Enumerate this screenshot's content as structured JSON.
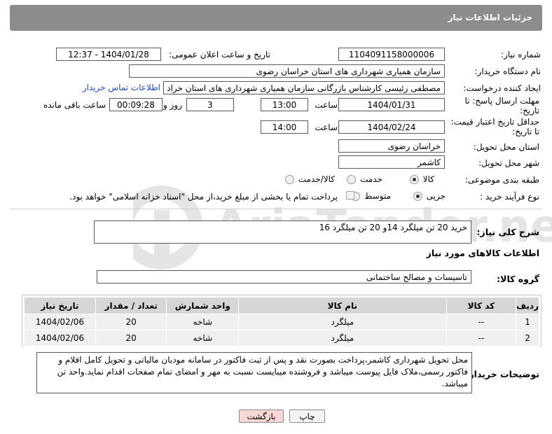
{
  "header": {
    "title": "جزئیات اطلاعات نیاز"
  },
  "fields": {
    "need_number_label": "شماره نیاز:",
    "need_number": "1104091158000006",
    "announce_label": "تاریخ و ساعت اعلان عمومی:",
    "announce_value": "1404/01/28 - 12:37",
    "buyer_org_label": "نام دستگاه خریدار:",
    "buyer_org": "سازمان همیاری شهرداری های استان خراسان رضوی",
    "creator_label": "ایجاد کننده درخواست:",
    "creator": "مصطفی رئیسی کارشناس بازرگانی سازمان همیاری شهرداری های استان خراد",
    "contact_link": "اطلاعات تماس خریدار",
    "deadline_label_1": "مهلت ارسال پاسخ: تا",
    "deadline_label_2": "تاریخ:",
    "deadline_date": "1404/01/31",
    "time_label": "ساعت",
    "deadline_time": "13:00",
    "days_value": "3",
    "days_label": "روز و",
    "remaining_time": "00:09:28",
    "remaining_label": "ساعت باقی مانده",
    "price_valid_label_1": "حداقل تاریخ اعتبار قیمت:",
    "price_valid_label_2": "تا تاریخ:",
    "price_valid_date": "1404/02/24",
    "price_valid_time": "14:00",
    "province_label": "استان محل تحویل:",
    "province": "خراسان رضوی",
    "city_label": "شهر محل تحویل:",
    "city": "کاشمر",
    "category_label": "طبقه بندی موضوعی:",
    "category_options": [
      "کالا",
      "خدمت",
      "کالا/خدمت"
    ],
    "purchase_type_label": "نوع فرآیند خرید :",
    "purchase_options": [
      "جزیی",
      "متوسط"
    ],
    "treasury_note": "پرداخت تمام یا بخشی از مبلغ خرید،از محل \"اسناد خزانه اسلامی\" خواهد بود."
  },
  "summary": {
    "label": "شرح کلی نیاز:",
    "value": "خرید 20 تن میلگرد 14و 20 تن میلگرد 16"
  },
  "goods": {
    "section_title": "اطلاعات کالاهای مورد نیاز",
    "group_label": "گروه کالا:",
    "group_value": "تاسیسات و مصالح ساختمانی",
    "columns": [
      "ردیف",
      "کد کالا",
      "نام کالا",
      "واحد شمارش",
      "تعداد / مقدار",
      "تاریخ نیاز"
    ],
    "rows": [
      [
        "1",
        "--",
        "میلگرد",
        "شاخه",
        "20",
        "1404/02/06"
      ],
      [
        "2",
        "--",
        "میلگرد",
        "شاخه",
        "20",
        "1404/02/06"
      ]
    ]
  },
  "buyer_notes": {
    "label": "توضیحات خریدار:",
    "text": "محل تحویل شهرداری کاشمر،پرداخت بصورت نقد و پس از ثبت فاکتور در سامانه مودیان مالیاتی و تحویل کامل اقلام و فاکتور رسمی،ملاک فایل پیوست میباشد و فروشنده میبایست نسبت به مهر و امضای تمام صفحات اقدام نماید.واحد تن میباشد."
  },
  "buttons": {
    "print": "چاپ",
    "back": "بازگشت"
  },
  "watermark": {
    "text": "AriaTender.net"
  },
  "colors": {
    "header_bg": "#8c8c8c",
    "link": "#1a4dc4",
    "table_header": "#d6d6d6",
    "back_button_bg": "#f7d7d7"
  }
}
